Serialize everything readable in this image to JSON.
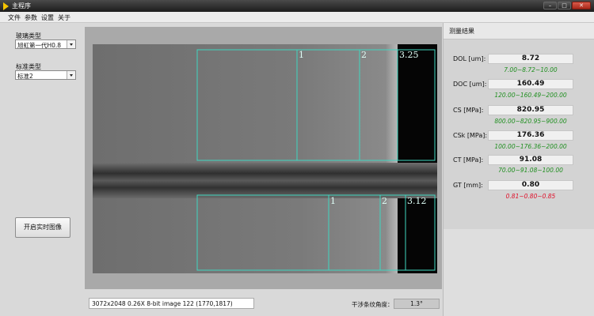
{
  "window": {
    "title": "主程序",
    "controls": [
      "–",
      "□",
      "✕"
    ]
  },
  "menu": [
    "文件",
    "参数",
    "设置",
    "关于"
  ],
  "left_panel": {
    "glass_type_label": "玻璃类型",
    "glass_type_value": "旭虹第一代H0.8",
    "standard_type_label": "标准类型",
    "standard_type_value": "标准2",
    "live_button": "开启实时图像"
  },
  "overlay_labels": {
    "top": [
      "1",
      "2",
      "3.25"
    ],
    "bottom": [
      "1",
      "2",
      "3.12"
    ]
  },
  "overlay_color": "#3fd6c0",
  "status": {
    "image_info": "3072x2048 0.26X 8-bit image 122     (1770,1817)",
    "angle_label": "干涉条纹角度：",
    "angle_value": "1.3°"
  },
  "results": {
    "header": "测量结果",
    "items": [
      {
        "label": "DOL [um]:",
        "value": "8.72",
        "range": "7.00~8.72~10.00",
        "range_color": "#1f8f1f"
      },
      {
        "label": "DOC [um]:",
        "value": "160.49",
        "range": "120.00~160.49~200.00",
        "range_color": "#1f8f1f"
      },
      {
        "label": "CS [MPa]:",
        "value": "820.95",
        "range": "800.00~820.95~900.00",
        "range_color": "#1f8f1f"
      },
      {
        "label": "CSk [MPa]:",
        "value": "176.36",
        "range": "100.00~176.36~200.00",
        "range_color": "#1f8f1f"
      },
      {
        "label": "CT [MPa]:",
        "value": "91.08",
        "range": "70.00~91.08~100.00",
        "range_color": "#1f8f1f"
      },
      {
        "label": "GT [mm]:",
        "value": "0.80",
        "range": "0.81~0.80~0.85",
        "range_color": "#e0102a"
      }
    ]
  }
}
